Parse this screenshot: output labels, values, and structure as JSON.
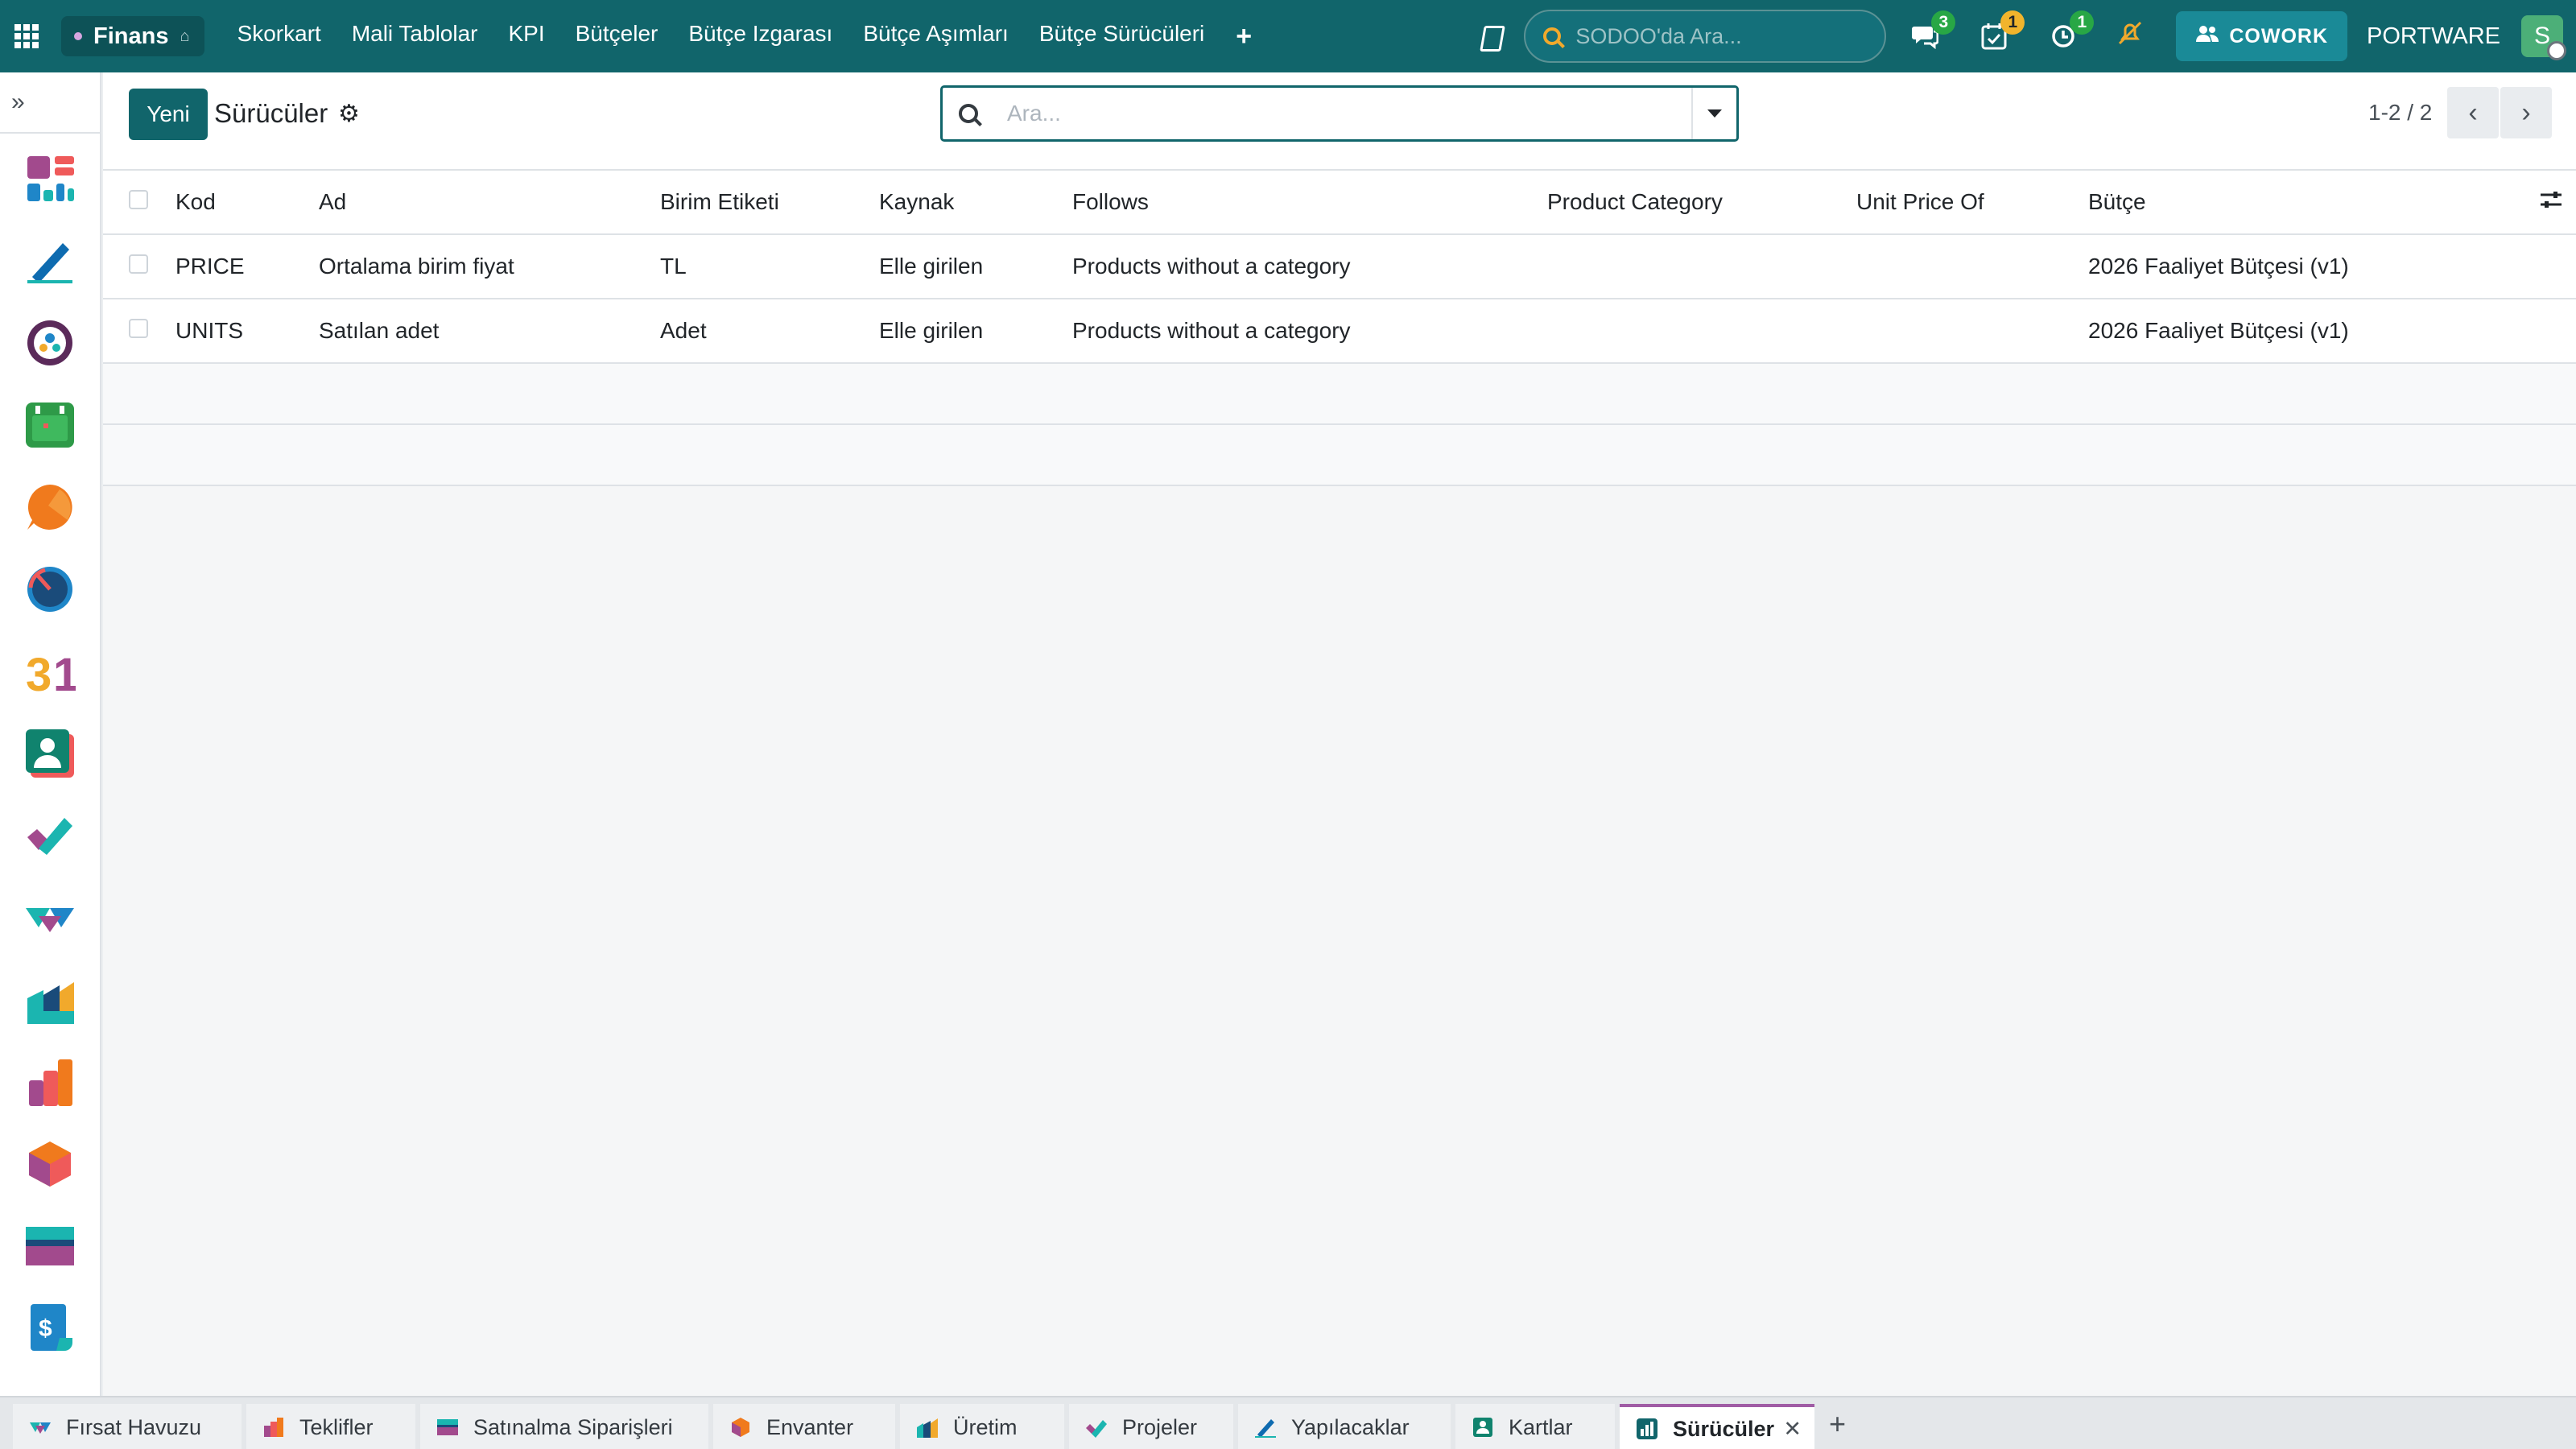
{
  "topbar": {
    "app_name": "Finans",
    "menu": [
      "Skorkart",
      "Mali Tablolar",
      "KPI",
      "Bütçeler",
      "Bütçe Izgarası",
      "Bütçe Aşımları",
      "Bütçe Sürücüleri"
    ],
    "add_menu": "+",
    "search_placeholder": "SODOO'da Ara...",
    "messages_count": "3",
    "activities_count": "1",
    "timer_count": "1",
    "cowork_label": "COWORK",
    "company": "PORTWARE",
    "avatar_letter": "S"
  },
  "control": {
    "new_label": "Yeni",
    "title": "Sürücüler",
    "search_placeholder": "Ara...",
    "pager": "1-2 / 2"
  },
  "list": {
    "columns": [
      "Kod",
      "Ad",
      "Birim Etiketi",
      "Kaynak",
      "Follows",
      "Product Category",
      "Unit Price Of",
      "Bütçe"
    ],
    "rows": [
      {
        "kod": "PRICE",
        "ad": "Ortalama birim fiyat",
        "birim": "TL",
        "kaynak": "Elle girilen",
        "follows": "Products without a category",
        "category": "",
        "unit_price_of": "",
        "butce": "2026 Faaliyet Bütçesi (v1)"
      },
      {
        "kod": "UNITS",
        "ad": "Satılan adet",
        "birim": "Adet",
        "kaynak": "Elle girilen",
        "follows": "Products without a category",
        "category": "",
        "unit_price_of": "",
        "butce": "2026 Faaliyet Bütçesi (v1)"
      }
    ]
  },
  "sidebar": {
    "apps": [
      "dashboard-icon",
      "pen-icon",
      "team-icon",
      "calendar-icon",
      "chat-icon",
      "gauge-icon",
      "calendar-31-icon",
      "contacts-icon",
      "check-icon",
      "handshake-icon",
      "factory-icon",
      "reports-icon",
      "inventory-icon",
      "purchase-icon",
      "invoice-icon"
    ]
  },
  "bottom_tabs": [
    {
      "label": "Fırsat Havuzu",
      "icon": "crm-icon"
    },
    {
      "label": "Teklifler",
      "icon": "sales-icon"
    },
    {
      "label": "Satınalma Siparişleri",
      "icon": "purchase-icon"
    },
    {
      "label": "Envanter",
      "icon": "inventory-icon"
    },
    {
      "label": "Üretim",
      "icon": "manufacturing-icon"
    },
    {
      "label": "Projeler",
      "icon": "project-icon"
    },
    {
      "label": "Yapılacaklar",
      "icon": "todo-icon"
    },
    {
      "label": "Kartlar",
      "icon": "contacts-icon"
    },
    {
      "label": "Sürücüler",
      "icon": "chart-icon",
      "active": true
    }
  ],
  "colors": {
    "primary": "#11656b",
    "accent_tab": "#a05ca5"
  }
}
